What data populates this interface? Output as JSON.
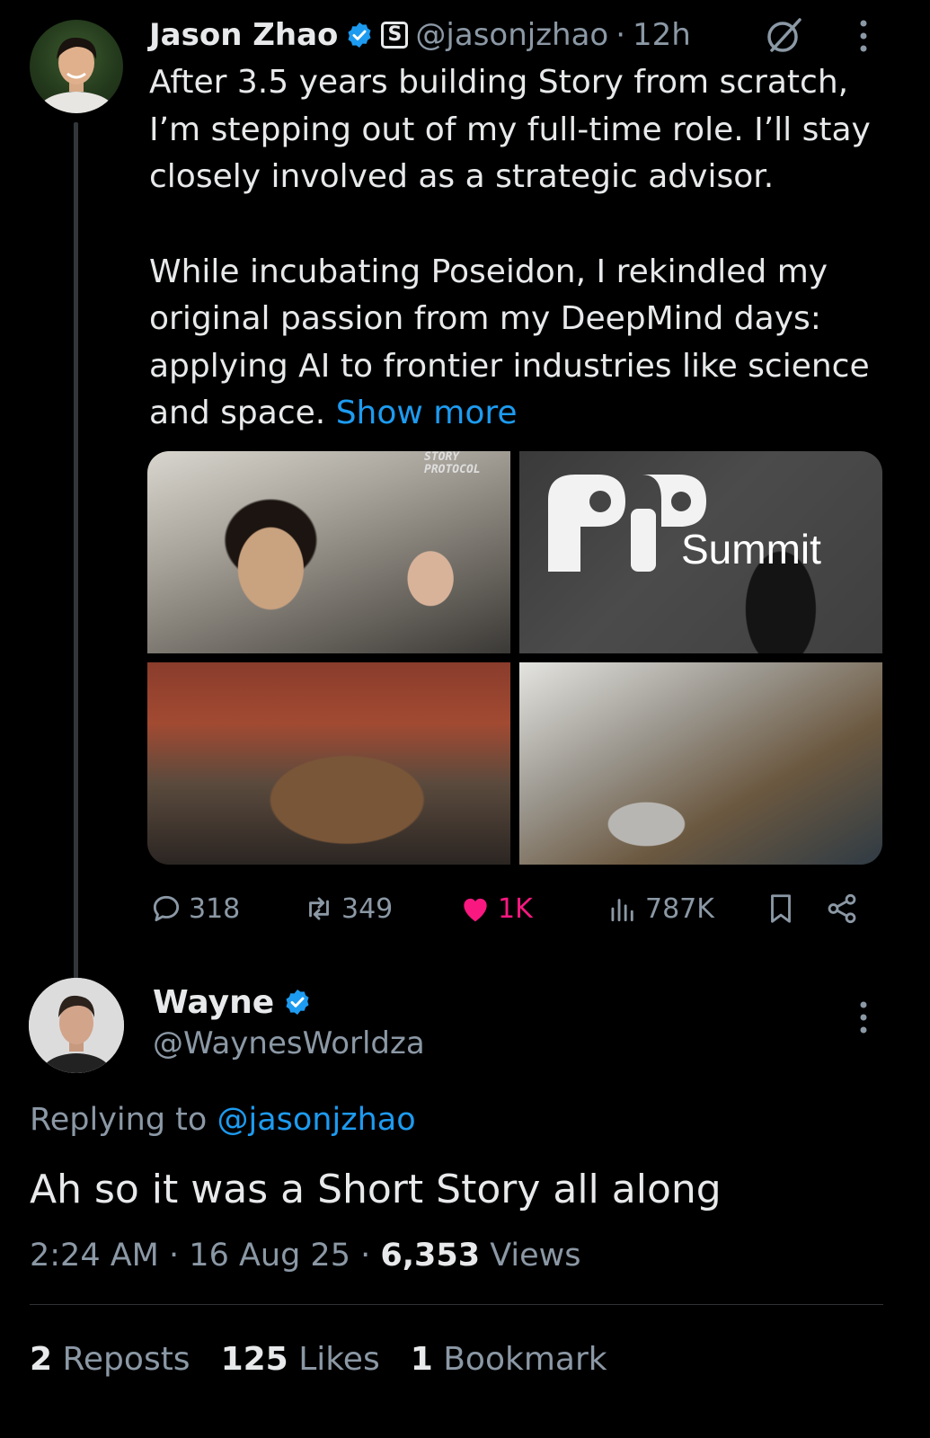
{
  "parent_tweet": {
    "author_name": "Jason Zhao",
    "brand_badge": "S",
    "handle": "@jasonjzhao",
    "separator": "·",
    "time": "12h",
    "body_lines_1": [
      "After 3.5 years building Story from scratch,",
      "I’m stepping out of my full-time role. I’ll stay",
      "closely involved as a strategic advisor."
    ],
    "body_lines_2": [
      "While incubating Poseidon, I rekindled my",
      "original passion from my DeepMind days:",
      "applying AI to frontier industries like science"
    ],
    "last_line": "and space.",
    "show_more": "Show more",
    "media": {
      "photo_1_sign": "STORY PROTOCOL",
      "photo_2_text": "Summit"
    },
    "actions": {
      "replies": "318",
      "reposts": "349",
      "likes": "1K",
      "views": "787K"
    }
  },
  "reply": {
    "author_name": "Wayne",
    "handle": "@WaynesWorldza",
    "replying_prefix": "Replying to",
    "replying_mention": "@jasonjzhao",
    "text": "Ah so it was a Short Story all along",
    "time": "2:24 AM",
    "date": "16 Aug 25",
    "separator": "·",
    "views_count": "6,353",
    "views_label": "Views",
    "reposts_count": "2",
    "reposts_label": "Reposts",
    "likes_count": "125",
    "likes_label": "Likes",
    "bookmarks_count": "1",
    "bookmarks_label": "Bookmark"
  },
  "colors": {
    "background": "#000000",
    "text": "#e7e9ea",
    "secondary": "#8b98a5",
    "link": "#1d9bf0",
    "like": "#f91880"
  }
}
